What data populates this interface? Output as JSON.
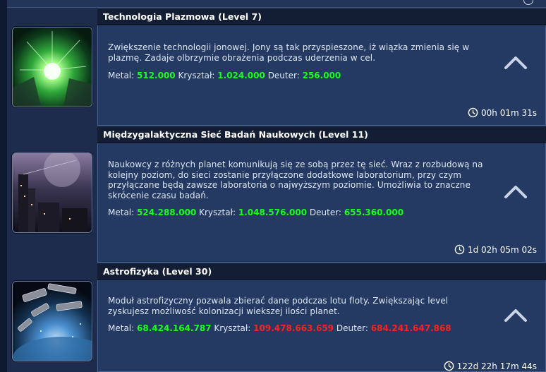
{
  "entries": [
    {
      "title": "Technologia Plazmowa (Level 7)",
      "description": "Zwiększenie technologii jonowej. Jony są tak przyspieszone, iż wiązka zmienia się w plazmę. Zadaje olbrzymie obrażenia podczas uderzenia w cel.",
      "image_icon": "plasma-technology-image",
      "costs": {
        "metal_label": "Metal:",
        "metal": "512.000",
        "metal_color": "#17ff17",
        "crystal_label": "Kryształ:",
        "crystal": "1.024.000",
        "crystal_color": "#17ff17",
        "deuterium_label": "Deuter:",
        "deuterium": "256.000",
        "deuterium_color": "#17ff17"
      },
      "timer": "00h 01m 31s"
    },
    {
      "title": "Międzygalaktyczna Sieć Badań Naukowych (Level 11)",
      "description": "Naukowcy z różnych planet komunikują się ze sobą przez tę sieć. Wraz z rozbudową na kolejny poziom, do sieci zostanie przyłączone dodatkowe laboratorium, przy czym przyłączane będą zawsze laboratoria o najwyższym poziomie. Umożliwia to znaczne skrócenie czasu badań.",
      "image_icon": "research-network-image",
      "costs": {
        "metal_label": "Metal:",
        "metal": "524.288.000",
        "metal_color": "#17ff17",
        "crystal_label": "Kryształ:",
        "crystal": "1.048.576.000",
        "crystal_color": "#17ff17",
        "deuterium_label": "Deuter:",
        "deuterium": "655.360.000",
        "deuterium_color": "#17ff17"
      },
      "timer": "1d 02h 05m 02s"
    },
    {
      "title": "Astrofizyka (Level 30)",
      "description": "Moduł astrofizyczny pozwala zbierać dane podczas lotu floty. Zwiększając level zyskujesz możliwość kolonizacji wiekszej ilości planet.",
      "image_icon": "astrophysics-image",
      "costs": {
        "metal_label": "Metal:",
        "metal": "68.424.164.787",
        "metal_color": "#17ff17",
        "crystal_label": "Kryształ:",
        "crystal": "109.478.663.659",
        "crystal_color": "#ff2020",
        "deuterium_label": "Deuter:",
        "deuterium": "684.241.647.868",
        "deuterium_color": "#ff2020"
      },
      "timer": "122d 22h 17m 44s"
    }
  ],
  "icons": {
    "expand": "chevron-up-icon",
    "timer": "clock-icon"
  }
}
